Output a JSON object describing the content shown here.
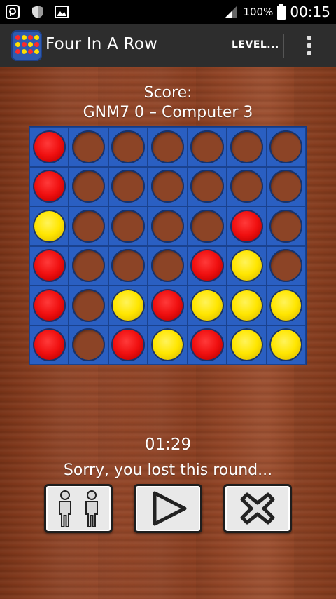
{
  "status_bar": {
    "battery_percent": "100%",
    "time": "00:15",
    "icons": [
      "notification-icon",
      "shield-icon",
      "image-icon",
      "signal-icon",
      "battery-icon"
    ]
  },
  "app_bar": {
    "title": "Four In A Row",
    "level_label": "LEVEL...",
    "overflow_icon": "more-vert-icon"
  },
  "score": {
    "label": "Score:",
    "line": "GNM7 0 – Computer 3"
  },
  "board": {
    "rows": 6,
    "cols": 7,
    "colors": {
      "red": "#e81414",
      "yellow": "#ffe000",
      "board": "#2a5fc2"
    },
    "cells": [
      [
        "red",
        "empty",
        "empty",
        "empty",
        "empty",
        "empty",
        "empty"
      ],
      [
        "red",
        "empty",
        "empty",
        "empty",
        "empty",
        "empty",
        "empty"
      ],
      [
        "yellow",
        "empty",
        "empty",
        "empty",
        "empty",
        "red",
        "empty"
      ],
      [
        "red",
        "empty",
        "empty",
        "empty",
        "red",
        "yellow",
        "empty"
      ],
      [
        "red",
        "empty",
        "yellow",
        "red",
        "yellow",
        "yellow",
        "yellow"
      ],
      [
        "red",
        "empty",
        "red",
        "yellow",
        "red",
        "yellow",
        "yellow"
      ]
    ]
  },
  "timer": "01:29",
  "message": "Sorry, you lost this round...",
  "buttons": [
    {
      "name": "two-player-button",
      "icon": "two-players-icon"
    },
    {
      "name": "play-button",
      "icon": "play-icon"
    },
    {
      "name": "close-button",
      "icon": "close-icon"
    }
  ]
}
